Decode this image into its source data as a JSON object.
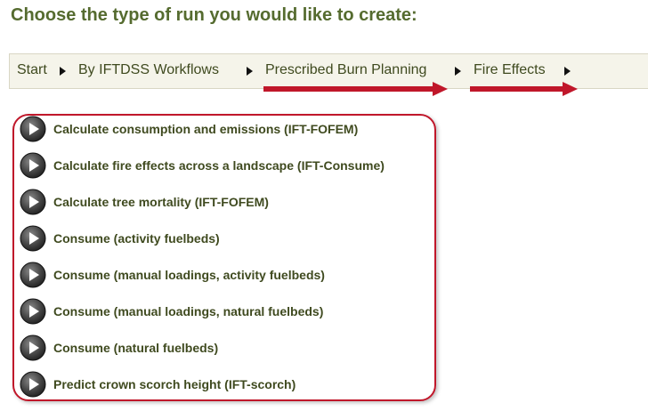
{
  "heading": "Choose the type of run you would like to create:",
  "breadcrumb": {
    "items": [
      {
        "label": "Start",
        "separator": "triangle-right-icon"
      },
      {
        "label": "By IFTDSS Workflows",
        "separator": "triangle-right-icon"
      },
      {
        "label": "Prescribed Burn Planning",
        "separator": "triangle-right-icon"
      },
      {
        "label": "Fire Effects",
        "separator": "triangle-right-icon"
      }
    ]
  },
  "options": [
    {
      "label": "Calculate consumption and emissions (IFT-FOFEM)",
      "icon": "play-button-icon"
    },
    {
      "label": "Calculate fire effects across a landscape (IFT-Consume)",
      "icon": "play-button-icon"
    },
    {
      "label": "Calculate tree mortality (IFT-FOFEM)",
      "icon": "play-button-icon"
    },
    {
      "label": "Consume (activity fuelbeds)",
      "icon": "play-button-icon"
    },
    {
      "label": "Consume (manual loadings, activity fuelbeds)",
      "icon": "play-button-icon"
    },
    {
      "label": "Consume (manual loadings, natural fuelbeds)",
      "icon": "play-button-icon"
    },
    {
      "label": "Consume (natural fuelbeds)",
      "icon": "play-button-icon"
    },
    {
      "label": "Predict crown scorch height (IFT-scorch)",
      "icon": "play-button-icon"
    }
  ],
  "colors": {
    "heading": "#556b2f",
    "text": "#3f4a1f",
    "breadcrumb_bg": "#f5f4ea",
    "annotation": "#c0172a"
  }
}
